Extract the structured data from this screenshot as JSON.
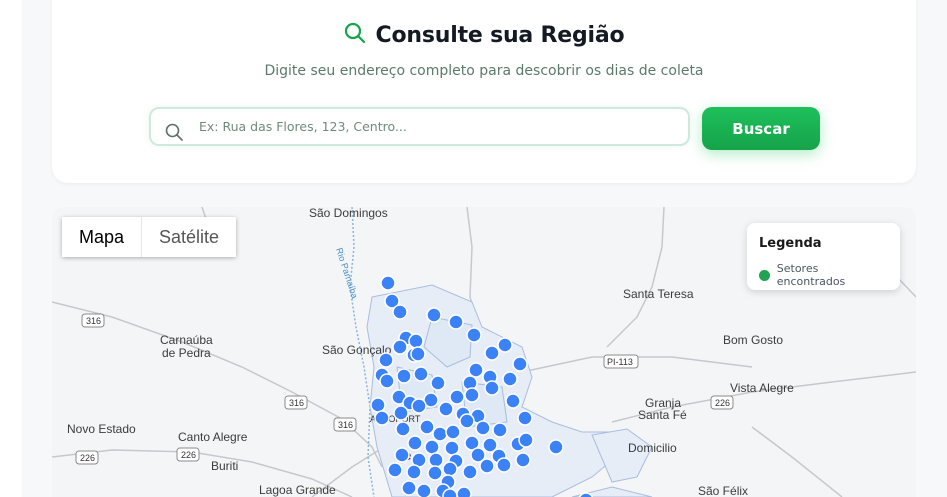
{
  "header": {
    "title": "Consulte sua Região",
    "subtitle": "Digite seu endereço completo para descobrir os dias de coleta",
    "search_placeholder": "Ex: Rua das Flores, 123, Centro...",
    "search_button": "Buscar",
    "title_icon": "search-icon"
  },
  "map": {
    "type_controls": {
      "map": "Mapa",
      "satellite": "Satélite",
      "active": "Mapa"
    },
    "legend": {
      "title": "Legenda",
      "item": "Setores encontrados",
      "item_color": "#22a253"
    },
    "marker_color": "#3b82f6",
    "places": {
      "sao_domingos": "São Domingos",
      "carnauba_1": "Carnaúba",
      "carnauba_2": "de Pedra",
      "sao_goncalo": "São Gonçalo",
      "santa_teresa": "Santa Teresa",
      "bom_gosto": "Bom Gosto",
      "vista_alegre": "Vista Alegre",
      "granja_1": "Granja",
      "granja_2": "Santa Fé",
      "novo_estado": "Novo Estado",
      "canto_alegre": "Canto Alegre",
      "buriti": "Buriti",
      "domicilio": "Domicilio",
      "lagoa_grande": "Lagoa Grande",
      "sao_felix": "São Félix",
      "city_partial": "Te",
      "aeroporto_partial": "AEROPORT"
    },
    "river": "Rio Parnaíba",
    "shields": {
      "r316_a": "316",
      "r316_b": "316",
      "r316_c": "316",
      "r226_a": "226",
      "r226_b": "226",
      "r226_c": "226",
      "pi113": "PI-113"
    }
  }
}
